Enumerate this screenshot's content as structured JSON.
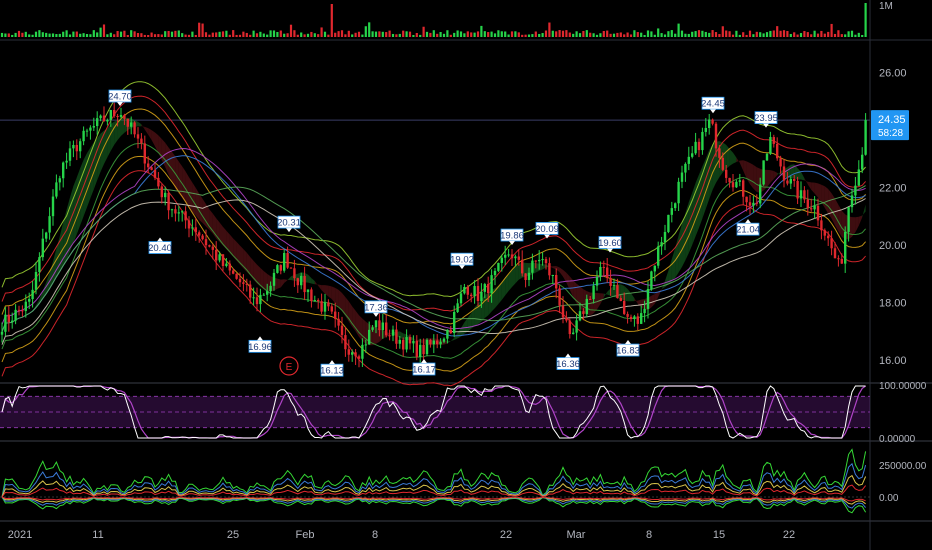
{
  "chart_data": [
    {
      "type": "bar",
      "panel": "volume",
      "axis_label": "1M",
      "colors": {
        "up": "#26d44a",
        "down": "#e0282e"
      }
    },
    {
      "type": "candlestick",
      "panel": "price",
      "y_ticks": [
        "26.00",
        "22.00",
        "20.00",
        "18.00",
        "16.00"
      ],
      "ylim": [
        15.3,
        27.0
      ],
      "last_price": "24.35",
      "countdown": "58:28",
      "price_path": [
        [
          0,
          17.2
        ],
        [
          15,
          17.6
        ],
        [
          30,
          18.0
        ],
        [
          45,
          20.4
        ],
        [
          60,
          22.6
        ],
        [
          75,
          23.4
        ],
        [
          90,
          24.0
        ],
        [
          105,
          24.4
        ],
        [
          120,
          24.7
        ],
        [
          135,
          23.8
        ],
        [
          150,
          22.7
        ],
        [
          165,
          21.6
        ],
        [
          180,
          21.0
        ],
        [
          195,
          20.6
        ],
        [
          210,
          19.9
        ],
        [
          225,
          19.2
        ],
        [
          240,
          18.7
        ],
        [
          255,
          18.0
        ],
        [
          270,
          18.6
        ],
        [
          285,
          19.6
        ],
        [
          300,
          18.7
        ],
        [
          315,
          18.1
        ],
        [
          330,
          17.6
        ],
        [
          345,
          16.5
        ],
        [
          360,
          16.3
        ],
        [
          375,
          17.3
        ],
        [
          390,
          16.9
        ],
        [
          405,
          16.6
        ],
        [
          420,
          16.3
        ],
        [
          435,
          16.6
        ],
        [
          450,
          17.1
        ],
        [
          465,
          18.6
        ],
        [
          480,
          18.2
        ],
        [
          495,
          18.9
        ],
        [
          510,
          19.8
        ],
        [
          525,
          18.9
        ],
        [
          540,
          19.6
        ],
        [
          555,
          18.7
        ],
        [
          570,
          16.6
        ],
        [
          585,
          17.9
        ],
        [
          600,
          19.1
        ],
        [
          615,
          18.6
        ],
        [
          625,
          17.5
        ],
        [
          640,
          17.3
        ],
        [
          650,
          18.9
        ],
        [
          665,
          20.6
        ],
        [
          680,
          22.2
        ],
        [
          695,
          23.3
        ],
        [
          710,
          24.3
        ],
        [
          725,
          22.6
        ],
        [
          740,
          22.0
        ],
        [
          755,
          21.3
        ],
        [
          770,
          23.7
        ],
        [
          785,
          22.4
        ],
        [
          800,
          21.7
        ],
        [
          815,
          21.3
        ],
        [
          830,
          20.0
        ],
        [
          840,
          19.1
        ],
        [
          850,
          21.8
        ],
        [
          860,
          22.8
        ],
        [
          866,
          24.35
        ]
      ],
      "highs": [
        {
          "label": "24.70",
          "x": 120,
          "value": 24.7
        },
        {
          "label": "20.31",
          "x": 289,
          "value": 20.31
        },
        {
          "label": "17.36",
          "x": 376,
          "value": 17.36
        },
        {
          "label": "19.02",
          "x": 462,
          "value": 19.02
        },
        {
          "label": "19.86",
          "x": 512,
          "value": 19.86
        },
        {
          "label": "20.09",
          "x": 547,
          "value": 20.09
        },
        {
          "label": "19.60",
          "x": 610,
          "value": 19.6
        },
        {
          "label": "24.45",
          "x": 713,
          "value": 24.45
        },
        {
          "label": "23.95",
          "x": 766,
          "value": 23.95
        }
      ],
      "lows": [
        {
          "label": "20.40",
          "x": 160,
          "value": 20.4
        },
        {
          "label": "16.96",
          "x": 260,
          "value": 16.96
        },
        {
          "label": "16.13",
          "x": 332,
          "value": 16.13
        },
        {
          "label": "16.17",
          "x": 424,
          "value": 16.17
        },
        {
          "label": "16.36",
          "x": 568,
          "value": 16.36
        },
        {
          "label": "16.83",
          "x": 628,
          "value": 16.83
        },
        {
          "label": "21.04",
          "x": 748,
          "value": 21.04
        }
      ],
      "earnings_marker": "E",
      "colors": {
        "up": "#26d44a",
        "down": "#e0282e",
        "last_badge": "#2196f3"
      }
    },
    {
      "type": "line",
      "panel": "oscillator",
      "y_ticks": [
        "100.00000",
        "0.00000"
      ],
      "ylim": [
        0,
        100
      ],
      "bands": [
        80,
        50,
        20
      ],
      "colors": {
        "fast": "#ffffff",
        "slow": "#b044c8",
        "band": "#8a3aa8"
      }
    },
    {
      "type": "area",
      "panel": "volume-oscillator",
      "y_ticks": [
        "250000.00",
        "0.00"
      ],
      "colors": {
        "outer": "#35d835",
        "mid": "#3b7bd8",
        "inner": "#e0282e"
      }
    }
  ],
  "x_axis": {
    "ticks": [
      {
        "label": "2021",
        "x": 20
      },
      {
        "label": "11",
        "x": 98
      },
      {
        "label": "25",
        "x": 233
      },
      {
        "label": "Feb",
        "x": 305
      },
      {
        "label": "8",
        "x": 375
      },
      {
        "label": "22",
        "x": 506
      },
      {
        "label": "Mar",
        "x": 576
      },
      {
        "label": "8",
        "x": 649
      },
      {
        "label": "15",
        "x": 719
      },
      {
        "label": "22",
        "x": 789
      }
    ]
  }
}
